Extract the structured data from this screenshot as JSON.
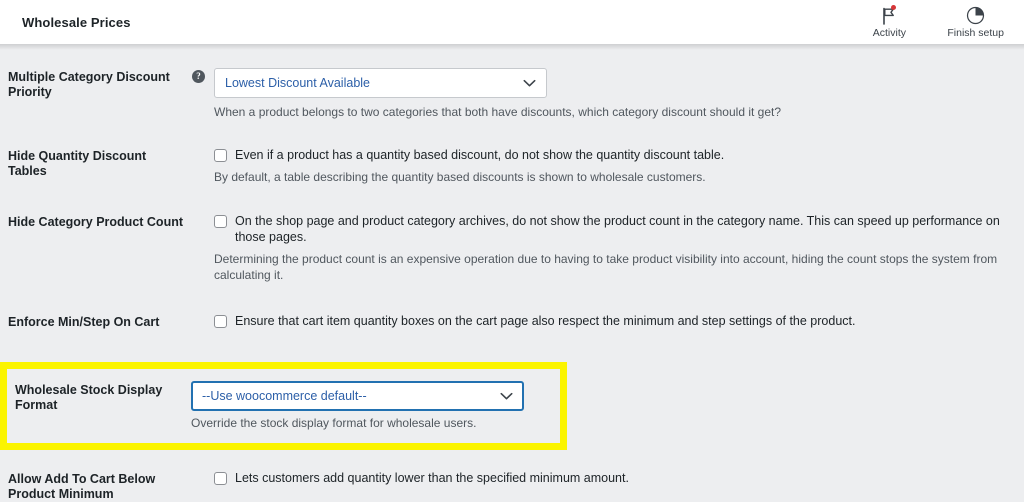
{
  "header": {
    "title": "Wholesale Prices",
    "actions": [
      {
        "label": "Activity",
        "icon": "flag-icon",
        "badge": true
      },
      {
        "label": "Finish setup",
        "icon": "progress-circle-icon",
        "badge": false
      }
    ]
  },
  "colors": {
    "page_background": "#edeef0",
    "header_background": "#ffffff",
    "link_blue": "#2c5fa8",
    "focus_blue": "#2271b1",
    "highlight_yellow": "#fbf400",
    "badge_red": "#d63638",
    "muted_text": "#50575e"
  },
  "settings": {
    "multiple_category_discount_priority": {
      "label": "Multiple Category Discount Priority",
      "help_icon": "question-mark-icon",
      "control": "select",
      "value": "Lowest Discount Available",
      "description": "When a product belongs to two categories that both have discounts, which category discount should it get?"
    },
    "hide_quantity_discount_tables": {
      "label": "Hide Quantity Discount Tables",
      "control": "checkbox",
      "checked": false,
      "checkbox_text": "Even if a product has a quantity based discount, do not show the quantity discount table.",
      "description": "By default, a table describing the quantity based discounts is shown to wholesale customers."
    },
    "hide_category_product_count": {
      "label": "Hide Category Product Count",
      "control": "checkbox",
      "checked": false,
      "checkbox_text": "On the shop page and product category archives, do not show the product count in the category name. This can speed up performance on those pages.",
      "description": "Determining the product count is an expensive operation due to having to take product visibility into account, hiding the count stops the system from calculating it."
    },
    "enforce_min_step_on_cart": {
      "label": "Enforce Min/Step On Cart",
      "control": "checkbox",
      "checked": false,
      "checkbox_text": "Ensure that cart item quantity boxes on the cart page also respect the minimum and step settings of the product."
    },
    "wholesale_stock_display_format": {
      "label": "Wholesale Stock Display Format",
      "control": "select",
      "value": "--Use woocommerce default--",
      "description": "Override the stock display format for wholesale users.",
      "highlighted": true,
      "focused": true
    },
    "allow_add_to_cart_below_product_minimum": {
      "label": "Allow Add To Cart Below Product Minimum",
      "control": "checkbox",
      "checked": false,
      "checkbox_text": "Lets customers add quantity lower than the specified minimum amount."
    }
  }
}
